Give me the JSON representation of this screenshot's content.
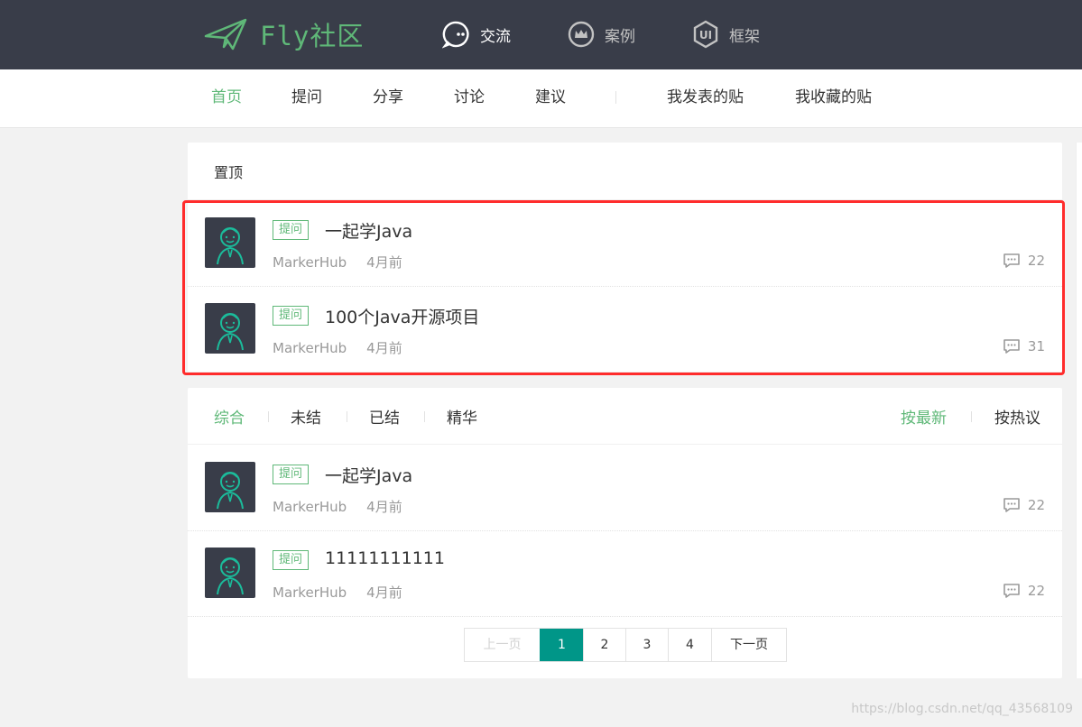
{
  "header": {
    "logo_text": "Fly社区",
    "nav": [
      {
        "label": "交流",
        "icon": "chat-bubble-icon",
        "active": true
      },
      {
        "label": "案例",
        "icon": "crown-icon",
        "active": false
      },
      {
        "label": "框架",
        "icon": "ui-badge-icon",
        "active": false
      }
    ]
  },
  "subnav": {
    "items": [
      "首页",
      "提问",
      "分享",
      "讨论",
      "建议"
    ],
    "user_items": [
      "我发表的贴",
      "我收藏的贴"
    ],
    "active": "首页"
  },
  "top_panel": {
    "title": "置顶",
    "posts": [
      {
        "badge": "提问",
        "title": "一起学Java",
        "author": "MarkerHub",
        "time": "4月前",
        "comments": "22"
      },
      {
        "badge": "提问",
        "title": "100个Java开源项目",
        "author": "MarkerHub",
        "time": "4月前",
        "comments": "31"
      }
    ]
  },
  "list_panel": {
    "filters": [
      "综合",
      "未结",
      "已结",
      "精华"
    ],
    "active_filter": "综合",
    "sorts": [
      "按最新",
      "按热议"
    ],
    "active_sort": "按最新",
    "posts": [
      {
        "badge": "提问",
        "title": "一起学Java",
        "author": "MarkerHub",
        "time": "4月前",
        "comments": "22"
      },
      {
        "badge": "提问",
        "title": "11111111111",
        "author": "MarkerHub",
        "time": "4月前",
        "comments": "22"
      }
    ]
  },
  "pagination": {
    "prev": "上一页",
    "pages": [
      "1",
      "2",
      "3",
      "4"
    ],
    "current": "1",
    "next": "下一页"
  },
  "watermark": "https://blog.csdn.net/qq_43568109",
  "colors": {
    "header_bg": "#393d49",
    "accent": "#5fb878",
    "pager_current": "#009688",
    "highlight": "#ff2c2c"
  }
}
